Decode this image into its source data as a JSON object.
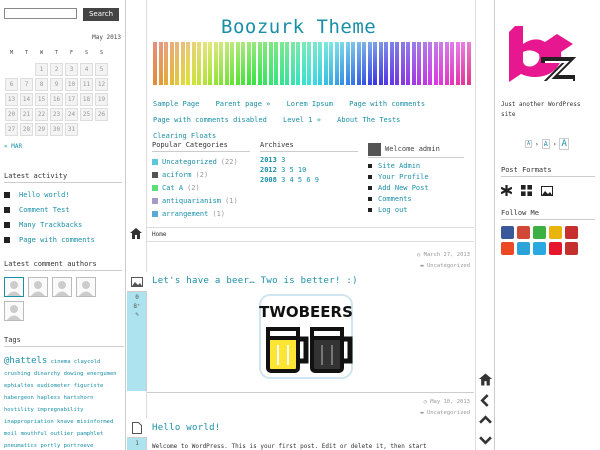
{
  "search": {
    "placeholder": "",
    "button": "Search"
  },
  "calendar": {
    "caption": "May 2013",
    "days": [
      "M",
      "T",
      "W",
      "T",
      "F",
      "S",
      "S"
    ],
    "weeks": [
      [
        "",
        "",
        "1",
        "2",
        "3",
        "4",
        "5"
      ],
      [
        "6",
        "7",
        "8",
        "9",
        "10",
        "11",
        "12"
      ],
      [
        "13",
        "14",
        "15",
        "16",
        "17",
        "18",
        "19"
      ],
      [
        "20",
        "21",
        "22",
        "23",
        "24",
        "25",
        "26"
      ],
      [
        "27",
        "28",
        "29",
        "30",
        "31",
        "",
        ""
      ]
    ],
    "prev": "« MAR"
  },
  "latest_activity": {
    "title": "Latest activity",
    "items": [
      "Hello world!",
      "Comment Test",
      "Many Trackbacks",
      "Page with comments"
    ]
  },
  "comment_authors": {
    "title": "Latest comment authors"
  },
  "tags": {
    "title": "Tags",
    "small": [
      "cinema",
      "claycold",
      "crushing",
      "dinarchy",
      "dowing",
      "energumen",
      "ephialtes",
      "eudiometer",
      "figuriste",
      "habergeon",
      "hapless",
      "hartshorn",
      "hostility",
      "impregnability",
      "inappropriation",
      "knave",
      "misinformed",
      "moil",
      "mouthful",
      "outlier",
      "pamphlet",
      "pneumatics",
      "portly",
      "portreeve"
    ],
    "lead": "@hattels",
    "big": "Post Formats"
  },
  "site": {
    "title": "Boozurk Theme",
    "tagline": "Just another WordPress site"
  },
  "nav": [
    "Sample Page",
    "Parent page »",
    "Lorem Ipsum",
    "Page with comments",
    "Page with comments disabled",
    "Level 1 »",
    "About The Tests",
    "Clearing Floats"
  ],
  "popular_categories": {
    "title": "Popular Categories",
    "items": [
      {
        "name": "Uncategorized",
        "count": "(22)",
        "color": "#5bc6de"
      },
      {
        "name": "aciform",
        "count": "(2)",
        "color": "#555555"
      },
      {
        "name": "Cat A",
        "count": "(2)",
        "color": "#5ce07a"
      },
      {
        "name": "antiquarianism",
        "count": "(1)",
        "color": "#a89ac8"
      },
      {
        "name": "arrangement",
        "count": "(1)",
        "color": "#5aa9d6"
      }
    ]
  },
  "archives": {
    "title": "Archives",
    "years": [
      {
        "year": "2013",
        "months": "3"
      },
      {
        "year": "2012",
        "months": "3 5 10"
      },
      {
        "year": "2008",
        "months": "3 4 5 6 9"
      }
    ]
  },
  "admin": {
    "title": "Welcome admin",
    "links": [
      "Site Admin",
      "Your Profile",
      "Add New Post",
      "Comments",
      "Log out"
    ]
  },
  "breadcrumb": "Home",
  "post1": {
    "title": "Let's have a beer… Two is better! :)",
    "date": "March 27, 2013",
    "category": "Uncategorized",
    "comments": "0",
    "image_text": "TWOBEERS"
  },
  "post2": {
    "title": "Hello world!",
    "date": "May 10, 2013",
    "category": "Uncategorized",
    "comments": "1",
    "excerpt": "Welcome to WordPress. This is your first post. Edit or delete it, then start"
  },
  "font_sizes": [
    "A",
    "›",
    "A",
    "›",
    "A"
  ],
  "post_formats": {
    "title": "Post Formats",
    "icons": [
      "asterisk-icon",
      "gallery-icon",
      "image-icon"
    ]
  },
  "follow": {
    "title": "Follow Me",
    "icons": [
      {
        "name": "facebook-icon",
        "color": "#3b5998"
      },
      {
        "name": "google-plus-icon",
        "color": "#d14836"
      },
      {
        "name": "clover-icon",
        "color": "#3cb043"
      },
      {
        "name": "delicious-icon",
        "color": "#e8b50c"
      },
      {
        "name": "deviantart-icon",
        "color": "#c92e2e"
      },
      {
        "name": "stumbleupon-icon",
        "color": "#eb4924"
      },
      {
        "name": "at-icon",
        "color": "#2aa3d9"
      },
      {
        "name": "twitter-icon",
        "color": "#2aa9e0"
      },
      {
        "name": "weibo-icon",
        "color": "#e6162d"
      },
      {
        "name": "youtube-icon",
        "color": "#c4302b"
      }
    ]
  }
}
